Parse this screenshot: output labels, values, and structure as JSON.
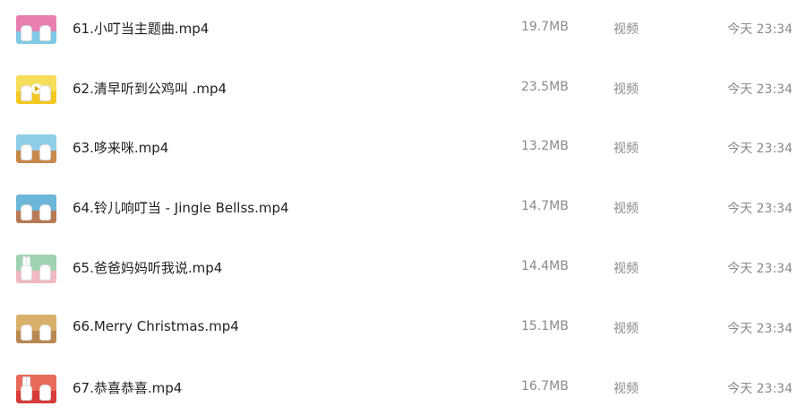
{
  "files": [
    {
      "name": "61.小叮当主题曲.mp4",
      "size": "19.7MB",
      "type": "视频",
      "modified": "今天 23:34",
      "thumb_icon": "video-thumbnail-icon",
      "thumb_colors": {
        "bg": "#7dc9e6",
        "sky": "#e87fb0"
      }
    },
    {
      "name": "62.清早听到公鸡叫 .mp4",
      "size": "23.5MB",
      "type": "视频",
      "modified": "今天 23:34",
      "thumb_icon": "video-thumbnail-icon",
      "thumb_colors": {
        "bg": "#f2c820",
        "sky": "#f6dd5a"
      }
    },
    {
      "name": "63.哆来咪.mp4",
      "size": "13.2MB",
      "type": "视频",
      "modified": "今天 23:34",
      "thumb_icon": "video-thumbnail-icon",
      "thumb_colors": {
        "bg": "#c9874a",
        "sky": "#8fcde8"
      }
    },
    {
      "name": "64.铃儿响叮当 - Jingle Bellss.mp4",
      "size": "14.7MB",
      "type": "视频",
      "modified": "今天 23:34",
      "thumb_icon": "video-thumbnail-icon",
      "thumb_colors": {
        "bg": "#b97a56",
        "sky": "#6bb6d9"
      }
    },
    {
      "name": "65.爸爸妈妈听我说.mp4",
      "size": "14.4MB",
      "type": "视频",
      "modified": "今天 23:34",
      "thumb_icon": "video-thumbnail-icon",
      "thumb_colors": {
        "bg": "#f0b8c0",
        "sky": "#9fd3b0"
      }
    },
    {
      "name": "66.Merry Christmas.mp4",
      "size": "15.1MB",
      "type": "视频",
      "modified": "今天 23:34",
      "thumb_icon": "video-thumbnail-icon",
      "thumb_colors": {
        "bg": "#b9874f",
        "sky": "#d8b06a"
      }
    },
    {
      "name": "67.恭喜恭喜.mp4",
      "size": "16.7MB",
      "type": "视频",
      "modified": "今天 23:34",
      "thumb_icon": "video-thumbnail-icon",
      "thumb_colors": {
        "bg": "#d93a3a",
        "sky": "#e86a5a"
      }
    }
  ]
}
